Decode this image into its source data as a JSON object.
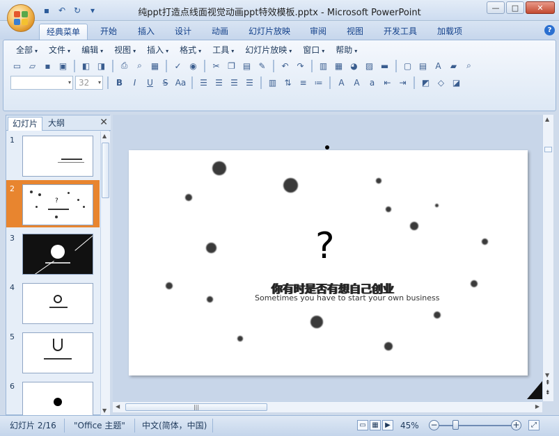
{
  "window": {
    "title": "纯ppt打造点线面视觉动画ppt特效模板.pptx - Microsoft PowerPoint",
    "minimize": "—",
    "maximize": "□",
    "close": "✕"
  },
  "ribbon_tabs": [
    "经典菜单",
    "开始",
    "插入",
    "设计",
    "动画",
    "幻灯片放映",
    "审阅",
    "视图",
    "开发工具",
    "加载项"
  ],
  "classic_menu": [
    "全部",
    "文件",
    "编辑",
    "视图",
    "插入",
    "格式",
    "工具",
    "幻灯片放映",
    "窗口",
    "帮助"
  ],
  "font": {
    "name": "",
    "size": "32"
  },
  "pane": {
    "tab_slides": "幻灯片",
    "tab_outline": "大纲",
    "close": "✕"
  },
  "thumbnails": [
    {
      "num": "1"
    },
    {
      "num": "2"
    },
    {
      "num": "3"
    },
    {
      "num": "4"
    },
    {
      "num": "5"
    },
    {
      "num": "6"
    }
  ],
  "slide": {
    "question_mark": "?",
    "title": "你有时是否有想自己创业",
    "subtitle": "Sometimes you have to start your own business"
  },
  "hscroll_grip": "|||",
  "status": {
    "slide_counter": "幻灯片 2/16",
    "theme": "\"Office 主题\"",
    "language": "中文(简体，中国)",
    "zoom": "45%"
  },
  "colors": {
    "accent_selected_thumb": "#e8852f",
    "ribbon_text": "#15428b"
  }
}
